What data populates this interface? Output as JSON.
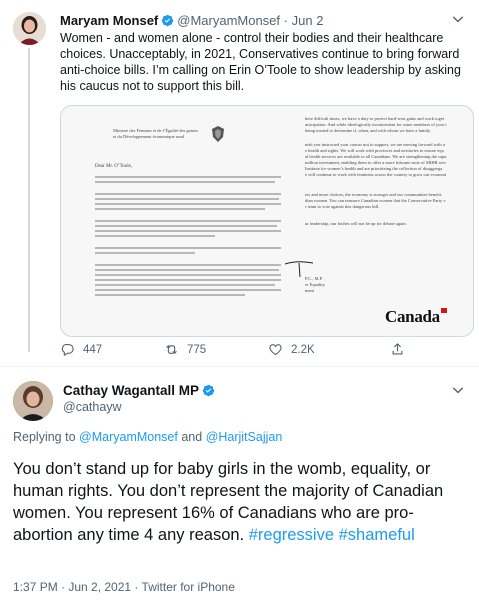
{
  "tweet1": {
    "author_name": "Maryam Monsef",
    "handle": "@MaryamMonsef",
    "separator": "·",
    "date": "Jun 2",
    "text": "Women - and women alone - control their bodies and their healthcare choices. Unacceptably, in 2021, Conservatives continue to bring forward anti-choice bills. I’m calling on Erin O’Toole to show leadership by asking his caucus not to support this bill.",
    "letter": {
      "header_line1": "Ministre des Femmes et de l’Égalité des genres",
      "header_line2": "et du Développement économique rural",
      "greeting": "Dear Mr. O’Toole,",
      "right_line1": "hese difficult times, we have a duty to protect hard-won gains and work toget",
      "right_line2": "articipation. And while ideologically inconvenient for some members of your t",
      "right_line3": "being trusted to determine if, when, and with whom we have a family.",
      "right_line4": "nish you instructed your caucus not to support, we are moving forward with a",
      "right_line5": "e health and rights. We will work with provinces and territories to ensure equ",
      "right_line6": "al health services are available to all Canadians. We are strengthening the capa",
      "right_line7": "million investment, enabling them to offer a more fulsome suite of SRHR serv",
      "right_line8": "Institute for women’s health and are prioritizing the collection of disaggrega",
      "right_line9": "e will continue to work with feminists across the country to grow our economi",
      "right_line10": "ers and more choices, the economy is stronger and our communities benefit.",
      "right_line11": "dian women. You can reassure Canadian women that the Conservative Party v",
      "right_line12": "r team to vote against this dangerous bill.",
      "right_line13": "ur leadership, our bodies will not be up for debate again.",
      "signoff1": "P.C., M.P.",
      "signoff2": "er Equality",
      "signoff3": "ment",
      "wordmark": "Canada"
    },
    "replies": "447",
    "retweets": "775",
    "likes": "2.2K"
  },
  "tweet2": {
    "author_name": "Cathay Wagantall MP",
    "handle": "@cathayw",
    "reply_prefix": "Replying to",
    "reply_to1": "@MaryamMonsef",
    "reply_and": "and",
    "reply_to2": "@HarjitSajjan",
    "text": "You don’t  stand up for baby girls in the womb, equality, or human rights. You don’t represent the majority of Canadian women. You represent 16% of Canadians who are pro-abortion any time 4 any reason. ",
    "hashtag1": "#regressive",
    "hashtag2": "#shameful",
    "timestamp": "1:37 PM · Jun 2, 2021 · Twitter for iPhone"
  },
  "colors": {
    "accent": "#1d9bf0",
    "secondary_text": "#536471",
    "primary_text": "#0f1419",
    "border": "#cfd9de"
  },
  "icons": [
    "verified-badge-icon",
    "caret-down-icon",
    "reply-icon",
    "retweet-icon",
    "like-icon",
    "share-icon",
    "crest-icon"
  ]
}
